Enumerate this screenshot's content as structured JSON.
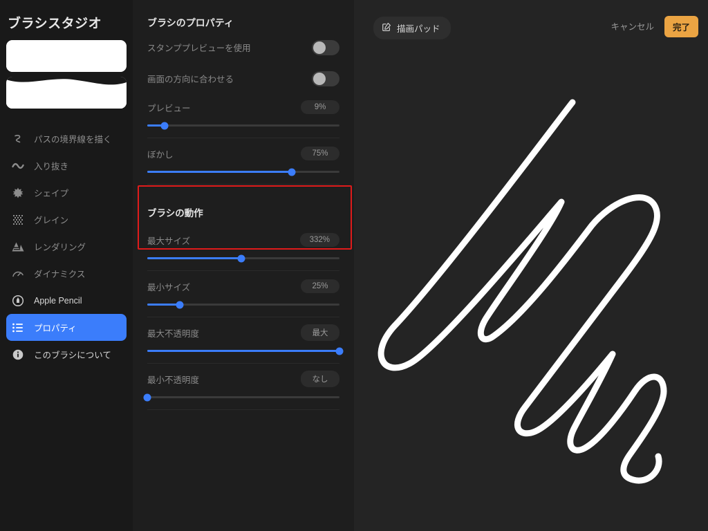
{
  "colors": {
    "accent_blue": "#3b7dfb",
    "done_orange": "#eba443",
    "highlight_red": "#e01b1b",
    "sidebar_bg": "#191919",
    "panel_bg": "#1e1e1e",
    "canvas_bg": "#242424",
    "stroke_white": "#ffffff"
  },
  "sidebar": {
    "title": "ブラシスタジオ",
    "brush_previews": [
      {
        "name": "brush-preview-1",
        "selected": false
      },
      {
        "name": "brush-preview-2",
        "selected": true
      }
    ],
    "items": [
      {
        "label": "パスの境界線を描く",
        "icon": "stroke-path-icon",
        "active": false,
        "bright": false
      },
      {
        "label": "入り抜き",
        "icon": "taper-wave-icon",
        "active": false,
        "bright": false
      },
      {
        "label": "シェイプ",
        "icon": "shape-star-icon",
        "active": false,
        "bright": false
      },
      {
        "label": "グレイン",
        "icon": "grain-dots-icon",
        "active": false,
        "bright": false
      },
      {
        "label": "レンダリング",
        "icon": "rendering-mountains-icon",
        "active": false,
        "bright": false
      },
      {
        "label": "ダイナミクス",
        "icon": "dynamics-gauge-icon",
        "active": false,
        "bright": false
      },
      {
        "label": "Apple Pencil",
        "icon": "apple-pencil-icon",
        "active": false,
        "bright": true
      },
      {
        "label": "プロパティ",
        "icon": "properties-list-icon",
        "active": true,
        "bright": true
      },
      {
        "label": "このブラシについて",
        "icon": "info-circle-icon",
        "active": false,
        "bright": true
      }
    ]
  },
  "properties_panel": {
    "title": "ブラシのプロパティ",
    "toggles": [
      {
        "label": "スタンププレビューを使用",
        "name": "use-stamp-preview-toggle",
        "on": false
      },
      {
        "label": "画面の方向に合わせる",
        "name": "orient-to-screen-toggle",
        "on": false
      }
    ],
    "sliders_top": [
      {
        "label": "プレビュー",
        "value_text": "9%",
        "percent": 9,
        "name": "preview-slider"
      },
      {
        "label": "ぼかし",
        "value_text": "75%",
        "percent": 75,
        "name": "smoothing-slider"
      }
    ],
    "behavior_section": {
      "title": "ブラシの動作",
      "sliders": [
        {
          "label": "最大サイズ",
          "value_text": "332%",
          "percent": 49,
          "name": "max-size-slider",
          "highlighted": true
        },
        {
          "label": "最小サイズ",
          "value_text": "25%",
          "percent": 17,
          "name": "min-size-slider",
          "highlighted": true
        },
        {
          "label": "最大不透明度",
          "value_text": "最大",
          "percent": 100,
          "name": "max-opacity-slider",
          "highlighted": false
        },
        {
          "label": "最小不透明度",
          "value_text": "なし",
          "percent": 0,
          "name": "min-opacity-slider",
          "highlighted": false
        }
      ]
    },
    "highlight_annotation": {
      "present": true,
      "covers": [
        "最大サイズ",
        "最小サイズ"
      ]
    }
  },
  "canvas": {
    "drawing_pad_label": "描画パッド",
    "drawing_pad_icon": "edit-square-pencil-icon",
    "cancel_label": "キャンセル",
    "done_label": "完了",
    "stroke_description": "白いアウトラインの落書きストローク"
  }
}
